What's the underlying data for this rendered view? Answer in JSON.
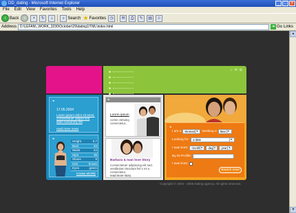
{
  "window": {
    "title": "DD_dating - Microsoft Internet Explorer",
    "controls": [
      "_",
      "□",
      "×"
    ]
  },
  "menu": [
    "File",
    "Edit",
    "View",
    "Favorites",
    "Tools",
    "Help"
  ],
  "toolbar": {
    "back_label": "Back",
    "search_label": "Search",
    "favorites_label": "Favorites"
  },
  "address": {
    "label": "Address",
    "url": "D:\\LEFAN\\_WORK_3230\\October\\29\\dating1\\TML\\index.html",
    "go_label": "Go",
    "links_label": "Links"
  },
  "site": {
    "nav_items": [
      "",
      "",
      "",
      "",
      ""
    ],
    "news": {
      "date": "17.05.2004",
      "text": "Lorem ipsum dolor sit amet, consectetuer adipisl sed diam nonummy elit",
      "read_more": "read more news"
    },
    "profile": {
      "stats": [
        {
          "label": "Height",
          "value": "5.7"
        },
        {
          "label": "Bust",
          "value": "34"
        },
        {
          "label": "Waist",
          "value": "24"
        },
        {
          "label": "Hips",
          "value": "35"
        },
        {
          "label": "Shoes",
          "value": "9"
        },
        {
          "label": "Hair",
          "value": "brown"
        },
        {
          "label": "Eyes",
          "value": "green"
        }
      ],
      "create_link": "Create MORE"
    },
    "card1": {
      "title": "Lorem ipsum",
      "text": "conse ctetuing consectetur..."
    },
    "story": {
      "title": "Barbara & Ivan love Story",
      "text": "Consectetuer adipiscing elit sed. vestibulum tincidunt feli s mi a consectetur.",
      "read_more": "read more story"
    },
    "search": {
      "i_am_label": "I am a",
      "i_am_value": "Woman",
      "seeking_label": "Seeking a",
      "seeking_value": "Man",
      "looking_label": "Looking for:",
      "looking_value": "a date",
      "born_label": "I was born:",
      "born_month": "month",
      "born_day": "day",
      "born_year": "year",
      "id_label": "By ID Profile:",
      "born_check_label": "I was born:",
      "button": "Search now!"
    },
    "footer": "Copyright © 2004 - 2005 Dating agency. All rights reserved."
  }
}
